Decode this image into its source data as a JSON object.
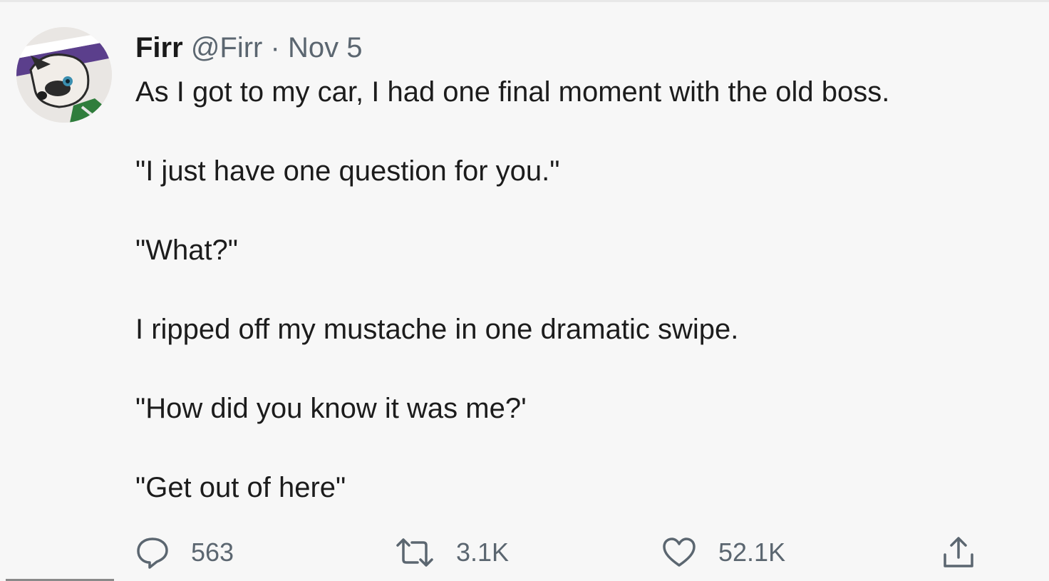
{
  "tweet": {
    "author": {
      "display_name": "Firr",
      "handle": "@Firr",
      "avatar_icon": "avatar-image"
    },
    "separator": "·",
    "date": "Nov 5",
    "lines": [
      "As I got to my car, I had one final moment with the old boss.",
      "\"I just have one question for you.\"",
      "\"What?\"",
      "I ripped off my mustache in one dramatic swipe.",
      "\"How did you know it was me?'",
      "\"Get out of here\""
    ],
    "actions": {
      "reply": {
        "icon": "reply-icon",
        "count": "563"
      },
      "retweet": {
        "icon": "retweet-icon",
        "count": "3.1K"
      },
      "like": {
        "icon": "heart-icon",
        "count": "52.1K"
      },
      "share": {
        "icon": "share-icon"
      }
    }
  },
  "colors": {
    "background": "#f7f7f7",
    "text": "#1c1c1c",
    "muted": "#5b6670"
  }
}
